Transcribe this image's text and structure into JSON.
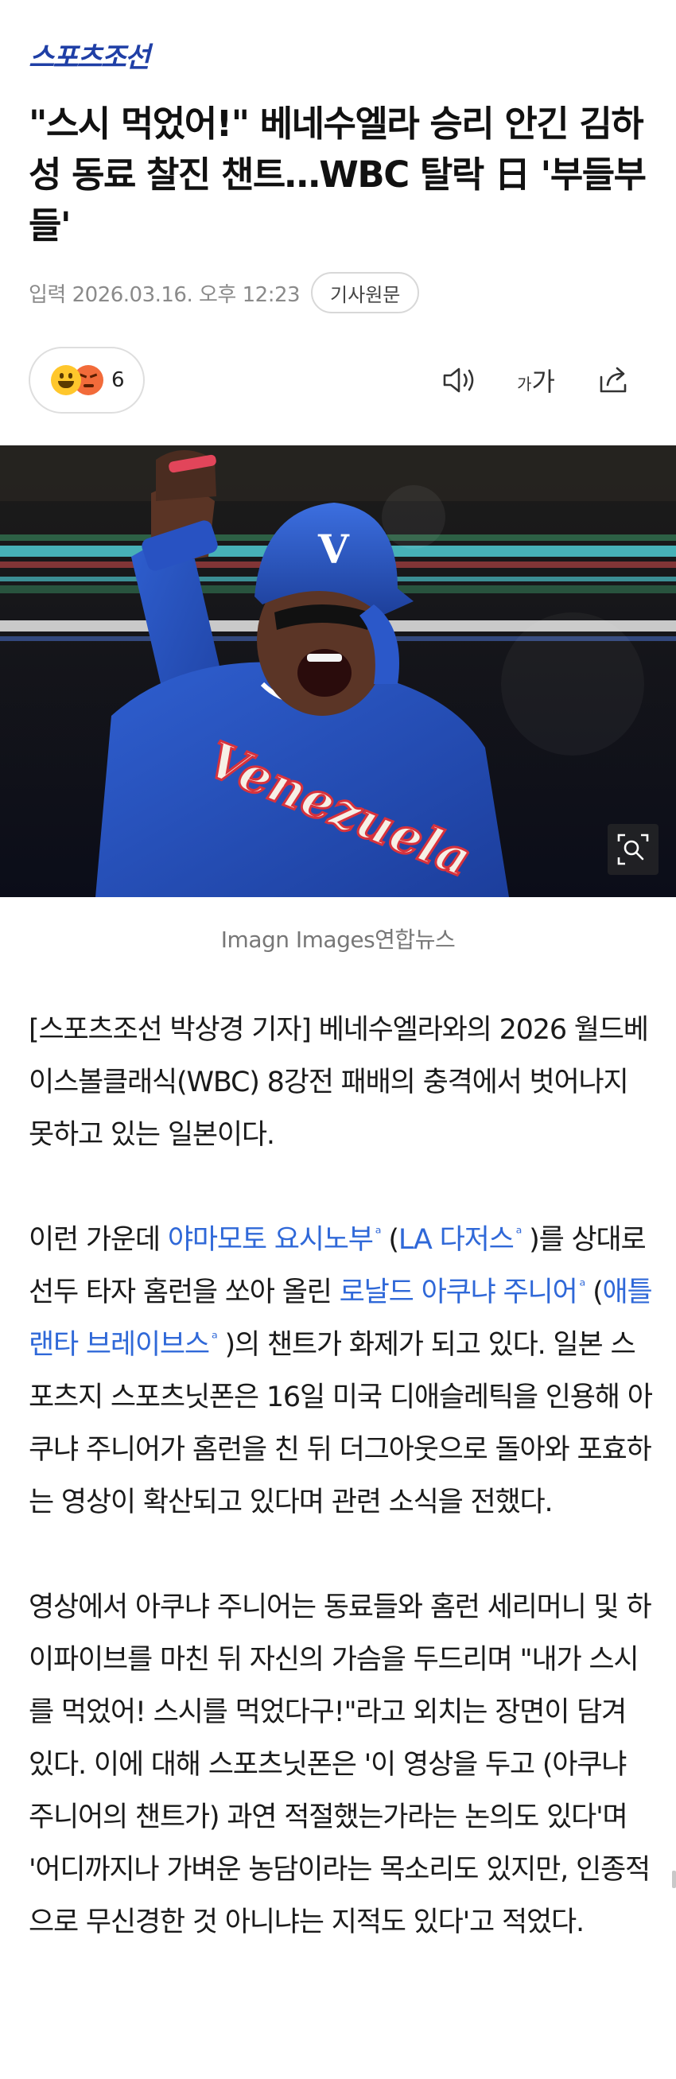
{
  "header": {
    "brand": "스포츠조선"
  },
  "article": {
    "headline": "\"스시 먹었어!\" 베네수엘라 승리 안긴 김하성 동료 찰진 챈트…WBC 탈락 日 '부들부들'",
    "date": "입력 2026.03.16. 오후 12:23",
    "original_button": "기사원문"
  },
  "toolbar": {
    "reaction_count": "6",
    "font_small": "가",
    "font_big": "가",
    "icons": [
      "speaker-icon",
      "font-size-icon",
      "share-icon"
    ]
  },
  "photo": {
    "caption": "Imagn Images연합뉴스",
    "jersey_text": "Venezuela",
    "helmet_letter": "V",
    "zoom_icon": "zoom-icon"
  },
  "body": {
    "p1": "[스포츠조선 박상경 기자] 베네수엘라와의 2026 월드베이스볼클래식(WBC) 8강전 패배의 충격에서 벗어나지 못하고 있는 일본이다.",
    "p2_a": "이런 가운데 ",
    "kw_yamamoto": "야마모토 요시노부",
    "p2_b": " (",
    "kw_dodgers": "LA 다저스",
    "p2_c": " )를 상대로 선두 타자 홈런을 쏘아 올린 ",
    "kw_acuna": "로날드 아쿠냐 주니어",
    "p2_d": " (",
    "kw_braves": "애틀랜타 브레이브스",
    "p2_e": " )의 챈트가 화제가 되고 있다. 일본 스포츠지 스포츠닛폰은 16일 미국 디애슬레틱을 인용해 아쿠냐 주니어가 홈런을 친 뒤 더그아웃으로 돌아와 포효하는 영상이 확산되고 있다며 관련 소식을 전했다.",
    "p3": "영상에서 아쿠냐 주니어는 동료들와 홈런 세리머니 및 하이파이브를 마친 뒤 자신의 가슴을 두드리며 \"내가 스시를 먹었어! 스시를 먹었다구!\"라고 외치는 장면이 담겨 있다. 이에 대해 스포츠닛폰은 '이 영상을 두고 (아쿠냐 주니어의 챈트가) 과연 적절했는가라는 논의도 있다'며 '어디까지나 가벼운 농담이라는 목소리도 있지만, 인종적으로 무신경한 것 아니냐는 지적도 있다'고 적었다.",
    "keyword_mark": "ᵃ"
  },
  "colors": {
    "brand": "#1f3fa6",
    "link": "#2f68d8",
    "meta": "#8a8a8a"
  }
}
